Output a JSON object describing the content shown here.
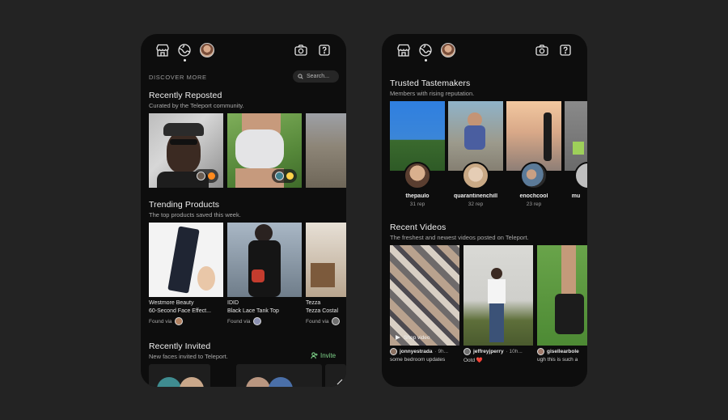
{
  "left": {
    "discover_more": "DISCOVER MORE",
    "search_placeholder": "Search...",
    "recently_reposted": {
      "title": "Recently Reposted",
      "subtitle": "Curated by the Teleport community."
    },
    "trending_products": {
      "title": "Trending Products",
      "subtitle": "The top products saved this week.",
      "items": [
        {
          "brand": "Westmore Beauty",
          "name": "60-Second Face Effect...",
          "found_via": "Found via"
        },
        {
          "brand": "IDID",
          "name": "Black Lace Tank Top",
          "found_via": "Found via"
        },
        {
          "brand": "Tezza",
          "name": "Tezza Costal",
          "found_via": "Found via"
        }
      ]
    },
    "recently_invited": {
      "title": "Recently Invited",
      "subtitle": "New faces invited to Teleport.",
      "invite_label": "Invite"
    }
  },
  "right": {
    "trusted_tastemakers": {
      "title": "Trusted Tastemakers",
      "subtitle": "Members with rising reputation.",
      "members": [
        {
          "name": "thepaulo",
          "rep": "31 rep"
        },
        {
          "name": "quarantinenchill",
          "rep": "32 rep"
        },
        {
          "name": "enochcool",
          "rep": "23 rep"
        },
        {
          "name": "mu",
          "rep": ""
        }
      ]
    },
    "recent_videos": {
      "title": "Recent Videos",
      "subtitle": "The freshest and newest videos posted on Teleport.",
      "shop_video_label": "Shop video",
      "videos": [
        {
          "user": "jonnyestrada",
          "time": "· 9h...",
          "caption": "some bedroom updates"
        },
        {
          "user": "jeffreyjperry",
          "time": "· 10h...",
          "caption": "Ootd ❤️"
        },
        {
          "user": "gisellearbole",
          "time": "",
          "caption": "ugh this is such a"
        }
      ]
    }
  },
  "icons": [
    "store-icon",
    "globe-icon",
    "camera-icon",
    "help-icon",
    "search-icon",
    "invite-user-icon",
    "chevron-right-icon"
  ],
  "colors": {
    "background": "#232323",
    "phone": "#0d0d0d",
    "accent_green": "#7fd48a"
  }
}
